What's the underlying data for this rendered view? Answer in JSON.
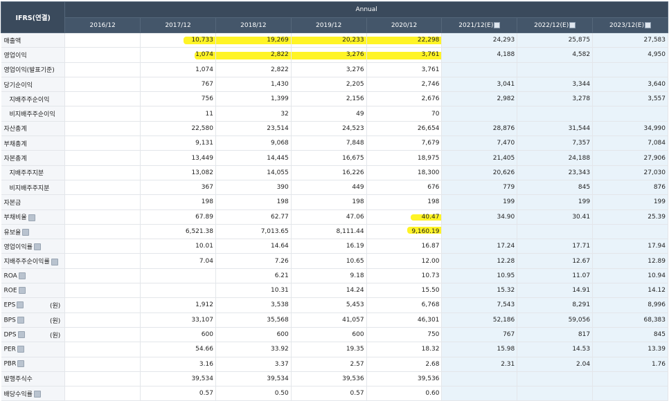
{
  "header": {
    "corner": "IFRS(연결)",
    "group": "Annual",
    "years": [
      "2016/12",
      "2017/12",
      "2018/12",
      "2019/12",
      "2020/12",
      "2021/12(E)",
      "2022/12(E)",
      "2023/12(E)"
    ]
  },
  "rows": [
    {
      "label": "매출액",
      "sub": false,
      "info": false,
      "unit": "",
      "values": [
        "",
        "10,733",
        "19,269",
        "20,233",
        "22,298",
        "24,293",
        "25,875",
        "27,583"
      ]
    },
    {
      "label": "영업이익",
      "sub": false,
      "info": false,
      "unit": "",
      "values": [
        "",
        "1,074",
        "2,822",
        "3,276",
        "3,761",
        "4,188",
        "4,582",
        "4,950"
      ]
    },
    {
      "label": "영업이익(발표기준)",
      "sub": false,
      "info": false,
      "unit": "",
      "values": [
        "",
        "1,074",
        "2,822",
        "3,276",
        "3,761",
        "",
        "",
        ""
      ]
    },
    {
      "label": "당기순이익",
      "sub": false,
      "info": false,
      "unit": "",
      "values": [
        "",
        "767",
        "1,430",
        "2,205",
        "2,746",
        "3,041",
        "3,344",
        "3,640"
      ]
    },
    {
      "label": "지배주주순이익",
      "sub": true,
      "info": false,
      "unit": "",
      "values": [
        "",
        "756",
        "1,399",
        "2,156",
        "2,676",
        "2,982",
        "3,278",
        "3,557"
      ]
    },
    {
      "label": "비지배주주순이익",
      "sub": true,
      "info": false,
      "unit": "",
      "values": [
        "",
        "11",
        "32",
        "49",
        "70",
        "",
        "",
        ""
      ]
    },
    {
      "label": "자산총계",
      "sub": false,
      "info": false,
      "unit": "",
      "values": [
        "",
        "22,580",
        "23,514",
        "24,523",
        "26,654",
        "28,876",
        "31,544",
        "34,990"
      ]
    },
    {
      "label": "부채총계",
      "sub": false,
      "info": false,
      "unit": "",
      "values": [
        "",
        "9,131",
        "9,068",
        "7,848",
        "7,679",
        "7,470",
        "7,357",
        "7,084"
      ]
    },
    {
      "label": "자본총계",
      "sub": false,
      "info": false,
      "unit": "",
      "values": [
        "",
        "13,449",
        "14,445",
        "16,675",
        "18,975",
        "21,405",
        "24,188",
        "27,906"
      ]
    },
    {
      "label": "지배주주지분",
      "sub": true,
      "info": false,
      "unit": "",
      "values": [
        "",
        "13,082",
        "14,055",
        "16,226",
        "18,300",
        "20,626",
        "23,343",
        "27,030"
      ]
    },
    {
      "label": "비지배주주지분",
      "sub": true,
      "info": false,
      "unit": "",
      "values": [
        "",
        "367",
        "390",
        "449",
        "676",
        "779",
        "845",
        "876"
      ]
    },
    {
      "label": "자본금",
      "sub": false,
      "info": false,
      "unit": "",
      "values": [
        "",
        "198",
        "198",
        "198",
        "198",
        "199",
        "199",
        "199"
      ]
    },
    {
      "label": "부채비율",
      "sub": false,
      "info": true,
      "unit": "",
      "values": [
        "",
        "67.89",
        "62.77",
        "47.06",
        "40.47",
        "34.90",
        "30.41",
        "25.39"
      ]
    },
    {
      "label": "유보율",
      "sub": false,
      "info": true,
      "unit": "",
      "values": [
        "",
        "6,521.38",
        "7,013.65",
        "8,111.44",
        "9,160.19",
        "",
        "",
        ""
      ]
    },
    {
      "label": "영업이익률",
      "sub": false,
      "info": true,
      "unit": "",
      "values": [
        "",
        "10.01",
        "14.64",
        "16.19",
        "16.87",
        "17.24",
        "17.71",
        "17.94"
      ]
    },
    {
      "label": "지배주주순이익률",
      "sub": false,
      "info": true,
      "unit": "",
      "values": [
        "",
        "7.04",
        "7.26",
        "10.65",
        "12.00",
        "12.28",
        "12.67",
        "12.89"
      ]
    },
    {
      "label": "ROA",
      "sub": false,
      "info": true,
      "unit": "",
      "values": [
        "",
        "",
        "6.21",
        "9.18",
        "10.73",
        "10.95",
        "11.07",
        "10.94"
      ]
    },
    {
      "label": "ROE",
      "sub": false,
      "info": true,
      "unit": "",
      "values": [
        "",
        "",
        "10.31",
        "14.24",
        "15.50",
        "15.32",
        "14.91",
        "14.12"
      ]
    },
    {
      "label": "EPS",
      "sub": false,
      "info": true,
      "unit": "(원)",
      "values": [
        "",
        "1,912",
        "3,538",
        "5,453",
        "6,768",
        "7,543",
        "8,291",
        "8,996"
      ]
    },
    {
      "label": "BPS",
      "sub": false,
      "info": true,
      "unit": "(원)",
      "values": [
        "",
        "33,107",
        "35,568",
        "41,057",
        "46,301",
        "52,186",
        "59,056",
        "68,383"
      ]
    },
    {
      "label": "DPS",
      "sub": false,
      "info": true,
      "unit": "(원)",
      "values": [
        "",
        "600",
        "600",
        "600",
        "750",
        "767",
        "817",
        "845"
      ]
    },
    {
      "label": "PER",
      "sub": false,
      "info": true,
      "unit": "",
      "values": [
        "",
        "54.66",
        "33.92",
        "19.35",
        "18.32",
        "15.98",
        "14.53",
        "13.39"
      ]
    },
    {
      "label": "PBR",
      "sub": false,
      "info": true,
      "unit": "",
      "values": [
        "",
        "3.16",
        "3.37",
        "2.57",
        "2.68",
        "2.31",
        "2.04",
        "1.76"
      ]
    },
    {
      "label": "발행주식수",
      "sub": false,
      "info": false,
      "unit": "",
      "values": [
        "",
        "39,534",
        "39,534",
        "39,536",
        "39,536",
        "",
        "",
        ""
      ]
    },
    {
      "label": "배당수익률",
      "sub": false,
      "info": true,
      "unit": "",
      "values": [
        "",
        "0.57",
        "0.50",
        "0.57",
        "0.60",
        "",
        "",
        ""
      ]
    }
  ],
  "colors": {
    "header": "#3a4a5c",
    "estimate_bg": "#e9f3fa",
    "label_bg": "#f4f6f9",
    "highlight": "#fff200"
  }
}
